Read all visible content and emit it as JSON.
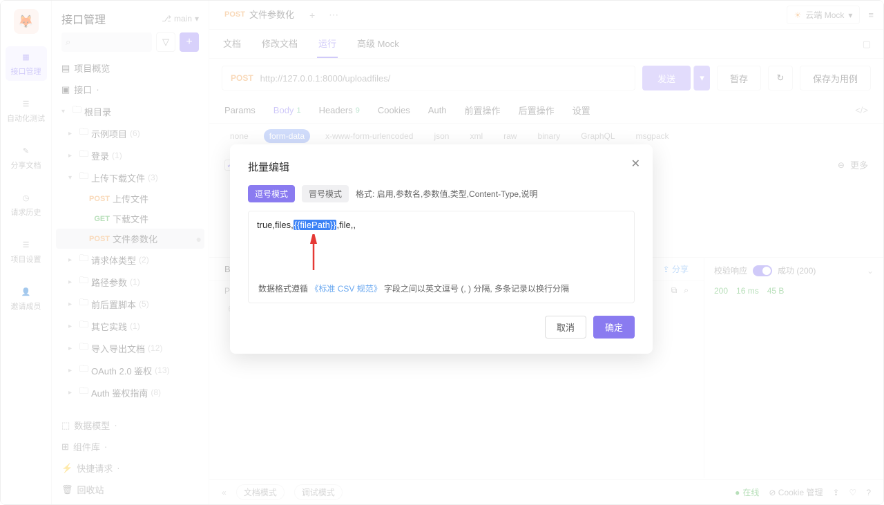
{
  "rail": {
    "items": [
      {
        "label": "接口管理"
      },
      {
        "label": "自动化测试"
      },
      {
        "label": "分享文档"
      },
      {
        "label": "请求历史"
      },
      {
        "label": "项目设置"
      },
      {
        "label": "邀请成员"
      }
    ]
  },
  "sidebar": {
    "title": "接口管理",
    "branch": "main",
    "search_placeholder": "",
    "sections": {
      "overview": "项目概览",
      "api": "接口",
      "root": "根目录",
      "data_model": "数据模型",
      "components": "组件库",
      "quick_request": "快捷请求",
      "recycle": "回收站"
    },
    "tree": [
      {
        "type": "folder",
        "label": "示例项目",
        "count": "(6)",
        "indent": 1
      },
      {
        "type": "folder",
        "label": "登录",
        "count": "(1)",
        "indent": 1
      },
      {
        "type": "folder",
        "label": "上传下载文件",
        "count": "(3)",
        "indent": 1,
        "open": true
      },
      {
        "type": "api",
        "method": "POST",
        "label": "上传文件",
        "indent": 2
      },
      {
        "type": "api",
        "method": "GET",
        "label": "下载文件",
        "indent": 2
      },
      {
        "type": "api",
        "method": "POST",
        "label": "文件参数化",
        "indent": 2,
        "selected": true
      },
      {
        "type": "folder",
        "label": "请求体类型",
        "count": "(2)",
        "indent": 1
      },
      {
        "type": "folder",
        "label": "路径参数",
        "count": "(1)",
        "indent": 1
      },
      {
        "type": "folder",
        "label": "前后置脚本",
        "count": "(5)",
        "indent": 1
      },
      {
        "type": "folder",
        "label": "其它实践",
        "count": "(1)",
        "indent": 1
      },
      {
        "type": "folder",
        "label": "导入导出文档",
        "count": "(12)",
        "indent": 1
      },
      {
        "type": "folder",
        "label": "OAuth 2.0 鉴权",
        "count": "(13)",
        "indent": 1
      },
      {
        "type": "folder",
        "label": "Auth 鉴权指南",
        "count": "(8)",
        "indent": 1
      }
    ]
  },
  "tabs": {
    "open": [
      {
        "method": "POST",
        "label": "文件参数化"
      }
    ],
    "mock": "云端 Mock"
  },
  "subtabs": [
    "文档",
    "修改文档",
    "运行",
    "高级 Mock"
  ],
  "subtab_active": 2,
  "url": {
    "method": "POST",
    "value": "http://127.0.0.1:8000/uploadfiles/"
  },
  "actions": {
    "send": "发送",
    "temp_save": "暂存",
    "save_case": "保存为用例"
  },
  "reqtabs": [
    {
      "label": "Params"
    },
    {
      "label": "Body",
      "badge": "1",
      "active": true
    },
    {
      "label": "Headers",
      "badge": "9"
    },
    {
      "label": "Cookies"
    },
    {
      "label": "Auth"
    },
    {
      "label": "前置操作"
    },
    {
      "label": "后置操作"
    },
    {
      "label": "设置"
    }
  ],
  "bodytypes": [
    "none",
    "form-data",
    "x-www-form-urlencoded",
    "json",
    "xml",
    "raw",
    "binary",
    "GraphQL",
    "msgpack"
  ],
  "bodytype_active": 1,
  "more": "更多",
  "response": {
    "tab_body": "B",
    "sub_pretty": "P",
    "share": "分享",
    "line_no": "6",
    "line_text": "]",
    "right_title": "校验响应",
    "right_status": "成功 (200)",
    "code": "200",
    "time": "16 ms",
    "size": "45 B"
  },
  "statusbar": {
    "mode_doc": "文档模式",
    "mode_debug": "调试模式",
    "online": "在线",
    "cookie": "Cookie 管理"
  },
  "modal": {
    "title": "批量编辑",
    "mode_comma": "逗号模式",
    "mode_colon": "冒号模式",
    "hint": "格式: 启用,参数名,参数值,类型,Content-Type,说明",
    "text_pre": "true,files,",
    "text_hl": "{{filePath}}",
    "text_post": ",file,,",
    "foot_pre": "数据格式遵循",
    "foot_link": "《标准 CSV 规范》",
    "foot_post": "字段之间以英文逗号 (, ) 分隔,  多条记录以换行分隔",
    "cancel": "取消",
    "ok": "确定"
  }
}
